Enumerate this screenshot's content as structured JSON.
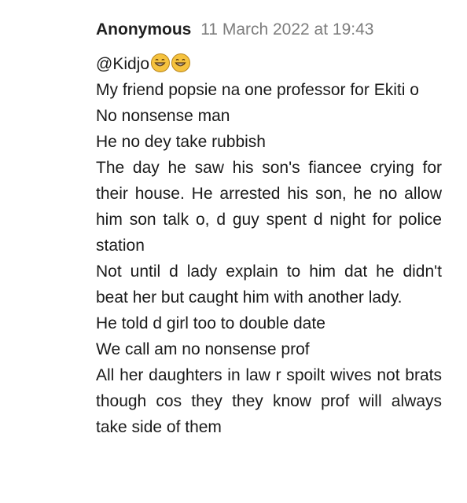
{
  "comment": {
    "author": "Anonymous",
    "timestamp": "11 March 2022 at 19:43",
    "mention": "@Kidjo",
    "emoji": [
      "grinning-face-with-smiling-eyes",
      "grinning-face-with-smiling-eyes"
    ],
    "paragraphs": [
      "My friend popsie na one professor for Ekiti o",
      "No nonsense man",
      "He no dey take rubbish",
      "The day he saw his son's fiancee crying for their house. He arrested his son, he no allow him son talk o, d guy spent d night for police station",
      "Not until d lady explain to him dat he didn't beat her but caught him with another lady.",
      "He told d girl too to double date",
      "We call am no nonsense prof",
      "All her daughters in law r spoilt wives not brats though cos they they know prof will always take side of them"
    ]
  }
}
